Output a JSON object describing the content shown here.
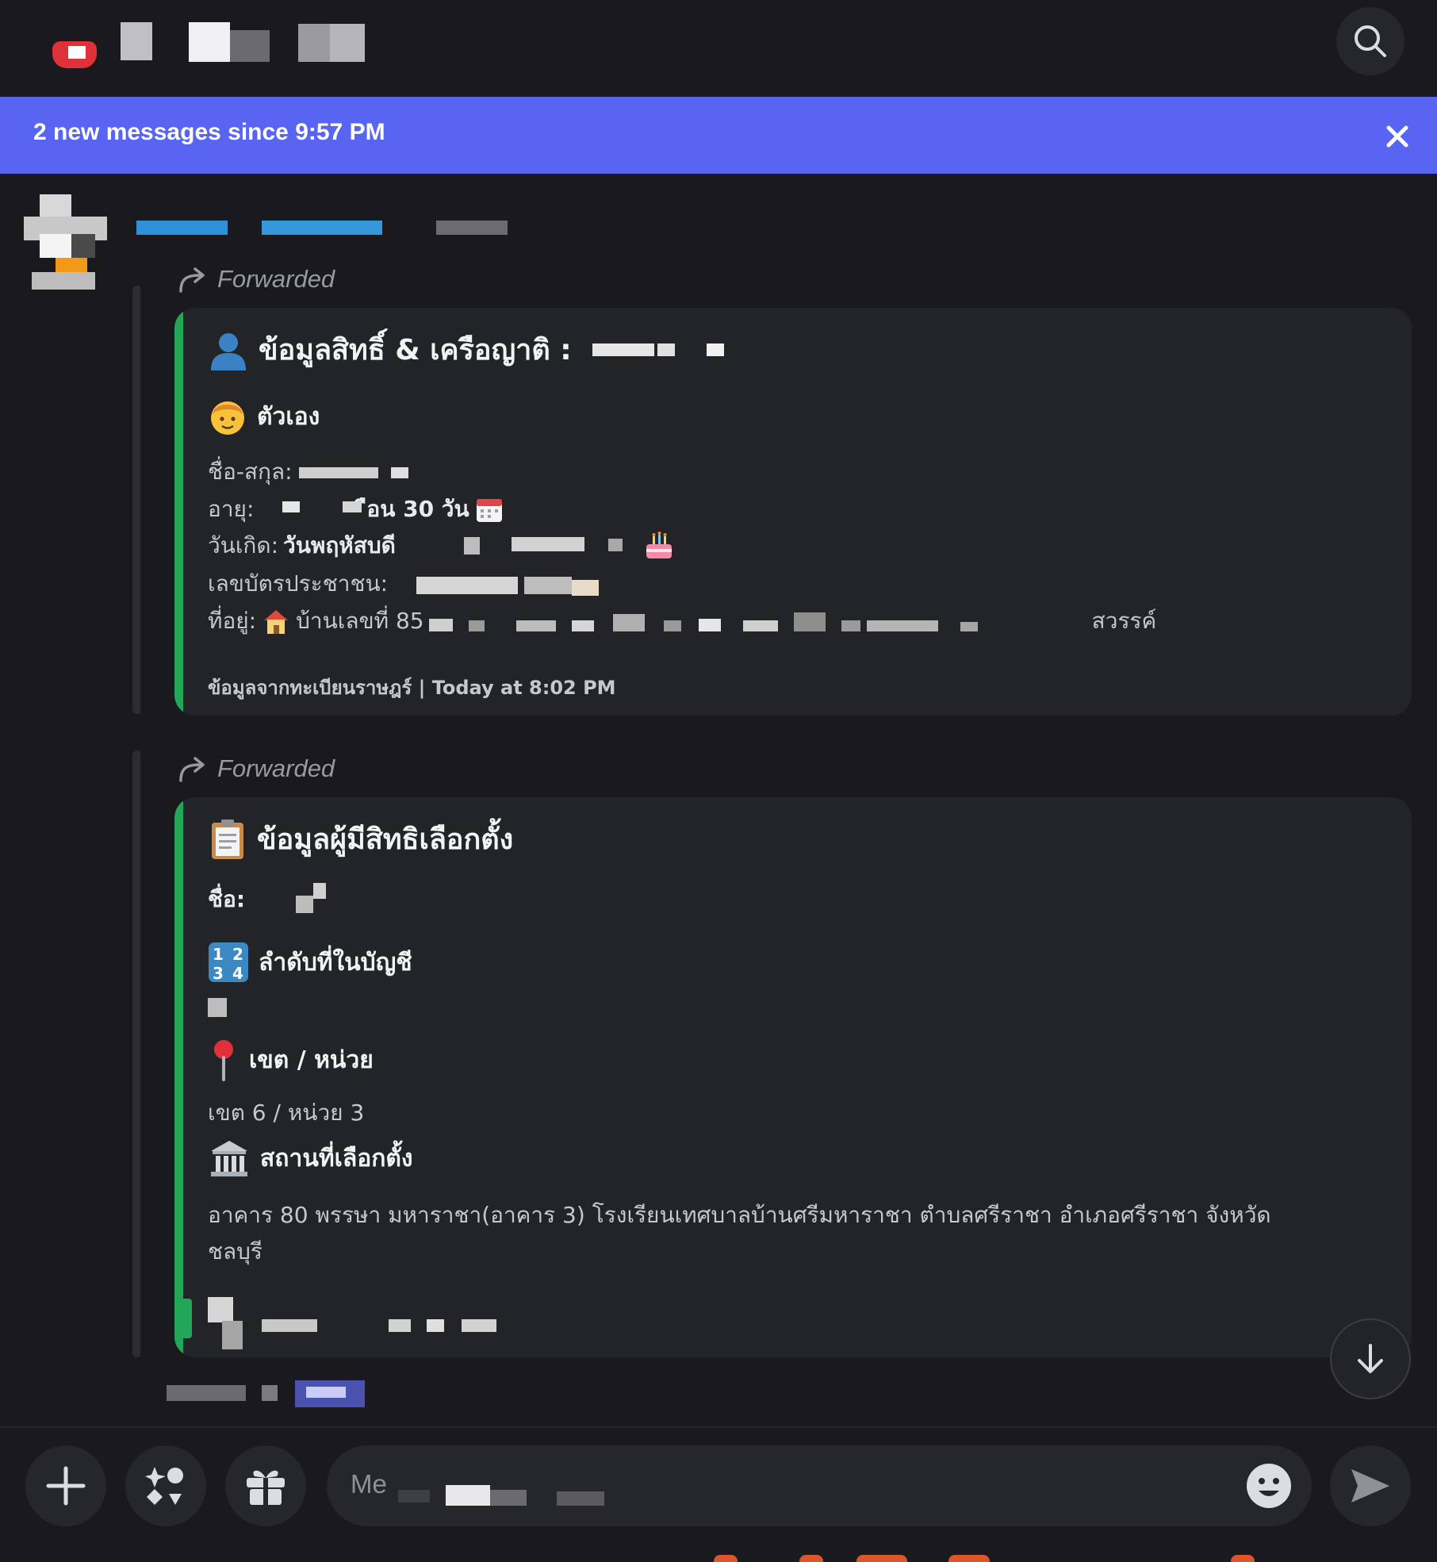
{
  "header": {
    "search_icon": "search-icon"
  },
  "banner": {
    "text": "2 new messages since 9:57 PM",
    "close_icon": "close-icon"
  },
  "messages": [
    {
      "forwarded_label": "Forwarded",
      "embed": {
        "title": "ข้อมูลสิทธิ์ & เครือญาติ :",
        "section_title": "ตัวเอง",
        "name_label": "ชื่อ-สกุล:",
        "age_label": "อายุ:",
        "age_value": "ือน 30 วัน",
        "birth_label": "วันเกิด:",
        "birth_value": "วันพฤหัสบดี",
        "id_label": "เลขบัตรประชาชน:",
        "address_label": "ที่อยู่:",
        "address_value": "บ้านเลขที่ 85",
        "address_tail": "สวรรค์",
        "footer": "ข้อมูลจากทะเบียนราษฎร์ | Today at 8:02 PM"
      }
    },
    {
      "forwarded_label": "Forwarded",
      "embed": {
        "title": "ข้อมูลผู้มีสิทธิเลือกตั้ง",
        "name_label": "ชื่อ:",
        "order_title": "ลำดับที่ในบัญชี",
        "zone_title": "เขต / หน่วย",
        "zone_value": "เขต 6 / หน่วย 3",
        "place_title": "สถานที่เลือกตั้ง",
        "place_value_line1": "อาคาร 80 พรรษา มหาราชา(อาคาร 3) โรงเรียนเทศบาลบ้านศรีมหาราชา  ตำบลศรีราชา อำเภอศรีราชา จังหวัด",
        "place_value_line2": "ชลบุรี"
      }
    }
  ],
  "composer": {
    "placeholder": "Me",
    "add_icon": "plus-icon",
    "apps_icon": "apps-icon",
    "gift_icon": "gift-icon",
    "emoji_icon": "emoji-icon",
    "send_icon": "send-icon"
  },
  "colors": {
    "accent": "#5865f2",
    "embed_bar": "#23a55a",
    "background": "#1a1a1e",
    "embed_bg": "#232428"
  }
}
